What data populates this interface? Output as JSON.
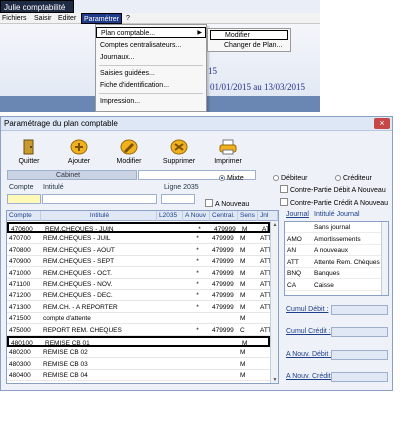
{
  "app": {
    "title": "Julie comptabilité",
    "menubar": [
      "Fichiers",
      "Saisir",
      "Editer",
      "Paramétrer",
      "?"
    ],
    "info_number": "15",
    "info_period": "01/01/2015 au 13/03/2015"
  },
  "menu_parametrer": {
    "items": [
      {
        "label": "Plan comptable...",
        "has_submenu": true,
        "highlighted": true
      },
      {
        "label": "Comptes centralisateurs..."
      },
      {
        "label": "Journaux..."
      },
      {
        "label": "Saisies guidées..."
      },
      {
        "label": "Fiche d'identification..."
      },
      {
        "label": "Impression..."
      }
    ],
    "submenu": [
      {
        "label": "Modifier",
        "highlighted": true
      },
      {
        "label": "Changer de Plan..."
      }
    ]
  },
  "param_window": {
    "title": "Paramétrage du plan comptable",
    "close_glyph": "×",
    "toolbar": [
      {
        "label": "Quitter",
        "icon": "exit-door-icon"
      },
      {
        "label": "Ajouter",
        "icon": "add-icon"
      },
      {
        "label": "Modifier",
        "icon": "edit-icon"
      },
      {
        "label": "Supprimer",
        "icon": "delete-icon"
      },
      {
        "label": "Imprimer",
        "icon": "printer-icon"
      }
    ],
    "cabinet_label": "Cabinet",
    "radios": {
      "mixte": "Mixte",
      "debiteur": "Débiteur",
      "crediteur": "Créditeur"
    },
    "checkboxes": {
      "a_nouveau": "A Nouveau",
      "contre_partie_debit": "Contre-Partie Débit A Nouveau",
      "contre_partie_credit": "Contre-Partie Crédit A Nouveau"
    },
    "search_labels": {
      "compte": "Compte",
      "intitule": "Intitulé",
      "ligne": "Ligne 2035"
    },
    "columns": [
      "Compte",
      "Intitulé",
      "L2035",
      "A Nouv",
      "Central.",
      "Sens",
      "Jnl"
    ],
    "rows": [
      {
        "compte": "470600",
        "intitule": "REM.CHEQUES - JUIN",
        "l2035": "",
        "anouv": "*",
        "central": "479999",
        "sens": "M",
        "jnl": "ATT",
        "selected": true
      },
      {
        "compte": "470700",
        "intitule": "REM.CHEQUES - JUIL",
        "l2035": "",
        "anouv": "*",
        "central": "479999",
        "sens": "M",
        "jnl": "ATT"
      },
      {
        "compte": "470800",
        "intitule": "REM.CHEQUES - AOUT",
        "l2035": "",
        "anouv": "*",
        "central": "479999",
        "sens": "M",
        "jnl": "ATT"
      },
      {
        "compte": "470900",
        "intitule": "REM.CHEQUES - SEPT",
        "l2035": "",
        "anouv": "*",
        "central": "479999",
        "sens": "M",
        "jnl": "ATT"
      },
      {
        "compte": "471000",
        "intitule": "REM.CHEQUES - OCT.",
        "l2035": "",
        "anouv": "*",
        "central": "479999",
        "sens": "M",
        "jnl": "ATT"
      },
      {
        "compte": "471100",
        "intitule": "REM.CHEQUES - NOV.",
        "l2035": "",
        "anouv": "*",
        "central": "479999",
        "sens": "M",
        "jnl": "ATT"
      },
      {
        "compte": "471200",
        "intitule": "REM.CHEQUES - DEC.",
        "l2035": "",
        "anouv": "*",
        "central": "479999",
        "sens": "M",
        "jnl": "ATT"
      },
      {
        "compte": "471300",
        "intitule": "REM.CH. - A REPORTER",
        "l2035": "",
        "anouv": "*",
        "central": "479999",
        "sens": "M",
        "jnl": "ATT"
      },
      {
        "compte": "471500",
        "intitule": "compte d'attente",
        "l2035": "",
        "anouv": "",
        "central": "",
        "sens": "M",
        "jnl": ""
      },
      {
        "compte": "475000",
        "intitule": "REPORT REM. CHEQUES",
        "l2035": "",
        "anouv": "*",
        "central": "479999",
        "sens": "C",
        "jnl": "ATT"
      },
      {
        "compte": "480100",
        "intitule": "REMISE CB 01",
        "l2035": "",
        "anouv": "",
        "central": "",
        "sens": "M",
        "jnl": "",
        "selected": true
      },
      {
        "compte": "480200",
        "intitule": "REMISE CB 02",
        "l2035": "",
        "anouv": "",
        "central": "",
        "sens": "M",
        "jnl": ""
      },
      {
        "compte": "480300",
        "intitule": "REMISE CB 03",
        "l2035": "",
        "anouv": "",
        "central": "",
        "sens": "M",
        "jnl": ""
      },
      {
        "compte": "480400",
        "intitule": "REMISE CB 04",
        "l2035": "",
        "anouv": "",
        "central": "",
        "sens": "M",
        "jnl": ""
      }
    ],
    "journal_columns": [
      "Journal",
      "Intitulé Journal"
    ],
    "journals": [
      {
        "code": "",
        "label": "Sans journal"
      },
      {
        "code": "AMO",
        "label": "Amortissements"
      },
      {
        "code": "AN",
        "label": "A nouveaux"
      },
      {
        "code": "ATT",
        "label": "Attente Rem. Chèques"
      },
      {
        "code": "BNQ",
        "label": "Banques"
      },
      {
        "code": "CA",
        "label": "Caisse"
      }
    ],
    "cumuls": {
      "debit": "Cumul Débit :",
      "credit": "Cumul Crédit :",
      "anouv_debit": "A Nouv. Débit :",
      "anouv_credit": "A Nouv. Crédit :"
    }
  }
}
